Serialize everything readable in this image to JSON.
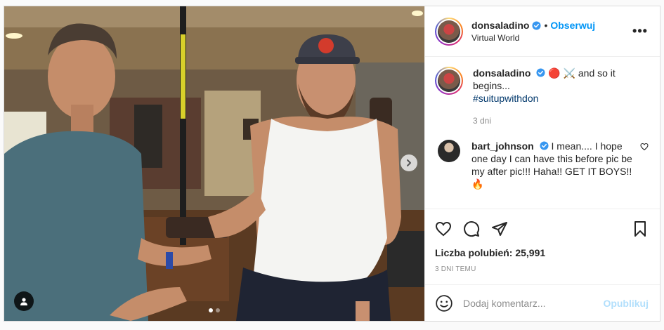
{
  "post": {
    "author": "donsaladino",
    "location": "Virtual World",
    "follow_label": "Obserwuj",
    "separator": "•",
    "more_label": "•••"
  },
  "caption": {
    "author": "donsaladino",
    "text": "🔴 ⚔️ and so it begins...",
    "hashtag": "#suitupwithdon",
    "time": "3 dni"
  },
  "comment": {
    "author": "bart_johnson",
    "text": "I mean.... I hope one day I can have this before pic be my after pic!!! Haha!! GET IT BOYS!! 🔥"
  },
  "likes": {
    "label": "Liczba polubień:",
    "count": "25,991"
  },
  "posted_ago": "3 DNI TEMU",
  "composer": {
    "placeholder": "Dodaj komentarz...",
    "publish_label": "Opublikuj"
  },
  "carousel": {
    "total": 2,
    "active": 1
  },
  "colors": {
    "accent": "#0095f6",
    "publish_disabled": "#b2dffc",
    "hashtag": "#00376b",
    "muted": "#8e8e8e"
  },
  "icons": [
    "verified-badge-icon",
    "more-options-icon",
    "heart-icon",
    "comment-icon",
    "share-icon",
    "save-icon",
    "emoji-icon",
    "user-tag-icon",
    "chevron-right-icon",
    "heart-small-icon"
  ]
}
